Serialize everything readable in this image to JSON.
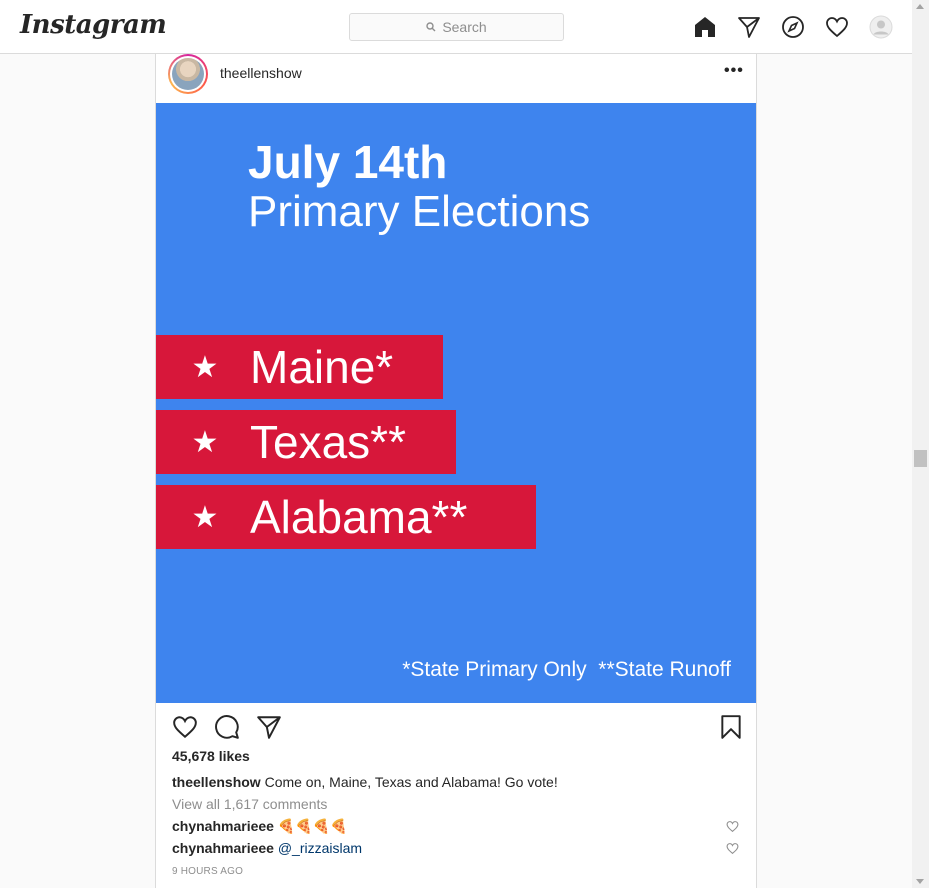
{
  "nav": {
    "logo": "Instagram",
    "search_placeholder": "Search",
    "icons": [
      "home-icon",
      "direct-icon",
      "explore-icon",
      "activity-heart-icon",
      "profile-avatar"
    ]
  },
  "post": {
    "username": "theellenshow",
    "more_label": "•••",
    "image": {
      "title_line1": "July 14th",
      "title_line2": "Primary Elections",
      "states": [
        {
          "star": "★",
          "name": "Maine*"
        },
        {
          "star": "★",
          "name": "Texas**"
        },
        {
          "star": "★",
          "name": "Alabama**"
        }
      ],
      "footnote": "*State Primary Only  **State Runoff",
      "colors": {
        "background": "#3e84ee",
        "banner": "#d7173a"
      }
    },
    "likes": "45,678 likes",
    "caption_user": "theellenshow",
    "caption_text": " Come on, Maine, Texas and Alabama! Go vote!",
    "view_all": "View all 1,617 comments",
    "comments": [
      {
        "user": "chynahmarieee",
        "text": " 🍕🍕🍕🍕",
        "mention": ""
      },
      {
        "user": "chynahmarieee",
        "text": " ",
        "mention": "@_rizzaislam"
      }
    ],
    "timestamp": "9 HOURS AGO"
  }
}
